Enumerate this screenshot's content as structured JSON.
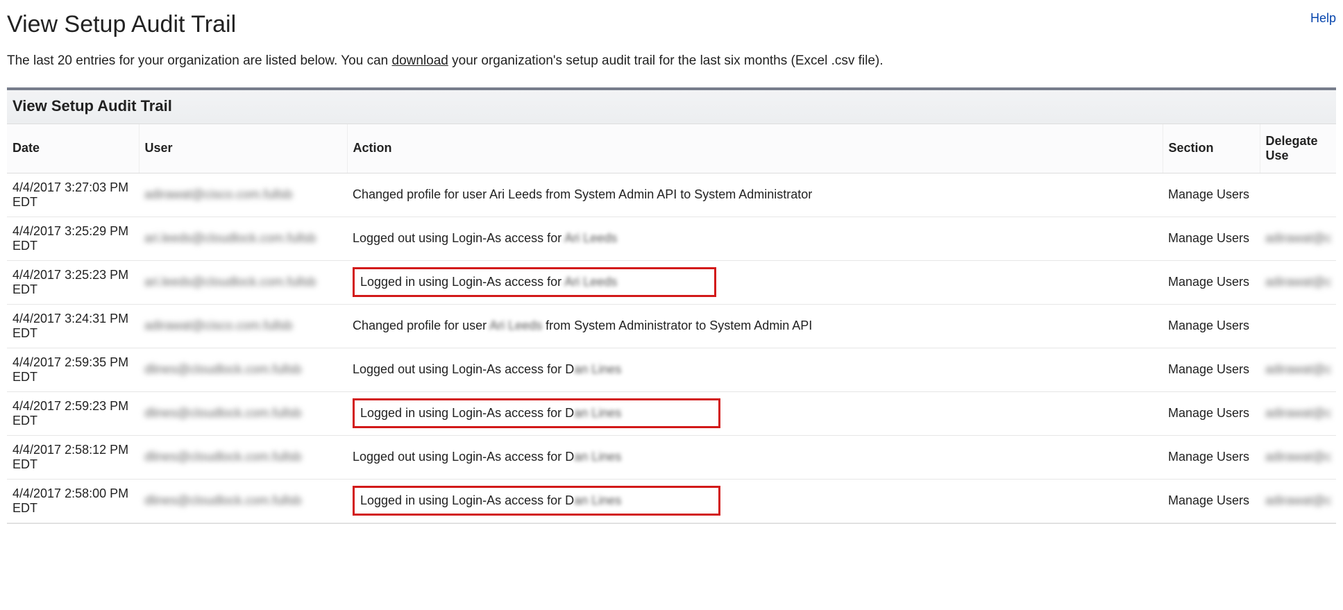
{
  "page": {
    "title": "View Setup Audit Trail",
    "help_label": "Help",
    "description_pre": "The last 20 entries for your organization are listed below. You can ",
    "download_label": "download",
    "description_post": " your organization's setup audit trail for the last six months (Excel .csv file)."
  },
  "panel": {
    "title": "View Setup Audit Trail",
    "columns": {
      "date": "Date",
      "user": "User",
      "action": "Action",
      "section": "Section",
      "delegate": "Delegate Use"
    }
  },
  "rows": [
    {
      "date": "4/4/2017 3:27:03 PM EDT",
      "user": "adirawat@cisco.com.fullsb",
      "action_pre": "Changed profile for user Ari Leeds from System Admin API to System Administrator",
      "action_blur": "",
      "section": "Manage Users",
      "delegate": "",
      "highlight": false
    },
    {
      "date": "4/4/2017 3:25:29 PM EDT",
      "user": "ari.leeds@cloudlock.com.fullsb",
      "action_pre": "Logged out using Login-As access for ",
      "action_blur": "Ari Leeds",
      "section": "Manage Users",
      "delegate": "adirawat@c",
      "highlight": false
    },
    {
      "date": "4/4/2017 3:25:23 PM EDT",
      "user": "ari.leeds@cloudlock.com.fullsb",
      "action_pre": "Logged in using Login-As access for ",
      "action_blur": "Ari Leeds",
      "section": "Manage Users",
      "delegate": "adirawat@c",
      "highlight": true
    },
    {
      "date": "4/4/2017 3:24:31 PM EDT",
      "user": "adirawat@cisco.com.fullsb",
      "action_pre": "Changed profile for user ",
      "action_blur": "Ari Leeds",
      "action_post": " from System Administrator to System Admin API",
      "section": "Manage Users",
      "delegate": "",
      "highlight": false
    },
    {
      "date": "4/4/2017 2:59:35 PM EDT",
      "user": "dlines@cloudlock.com.fullsb",
      "action_pre": "Logged out using Login-As access for D",
      "action_blur": "an Lines",
      "section": "Manage Users",
      "delegate": "adirawat@c",
      "highlight": false
    },
    {
      "date": "4/4/2017 2:59:23 PM EDT",
      "user": "dlines@cloudlock.com.fullsb",
      "action_pre": "Logged in using Login-As access for D",
      "action_blur": "an Lines",
      "section": "Manage Users",
      "delegate": "adirawat@c",
      "highlight": true
    },
    {
      "date": "4/4/2017 2:58:12 PM EDT",
      "user": "dlines@cloudlock.com.fullsb",
      "action_pre": "Logged out using Login-As access for D",
      "action_blur": "an Lines",
      "section": "Manage Users",
      "delegate": "adirawat@c",
      "highlight": false
    },
    {
      "date": "4/4/2017 2:58:00 PM EDT",
      "user": "dlines@cloudlock.com.fullsb",
      "action_pre": "Logged in using Login-As access for D",
      "action_blur": "an Lines",
      "section": "Manage Users",
      "delegate": "adirawat@c",
      "highlight": true
    }
  ]
}
